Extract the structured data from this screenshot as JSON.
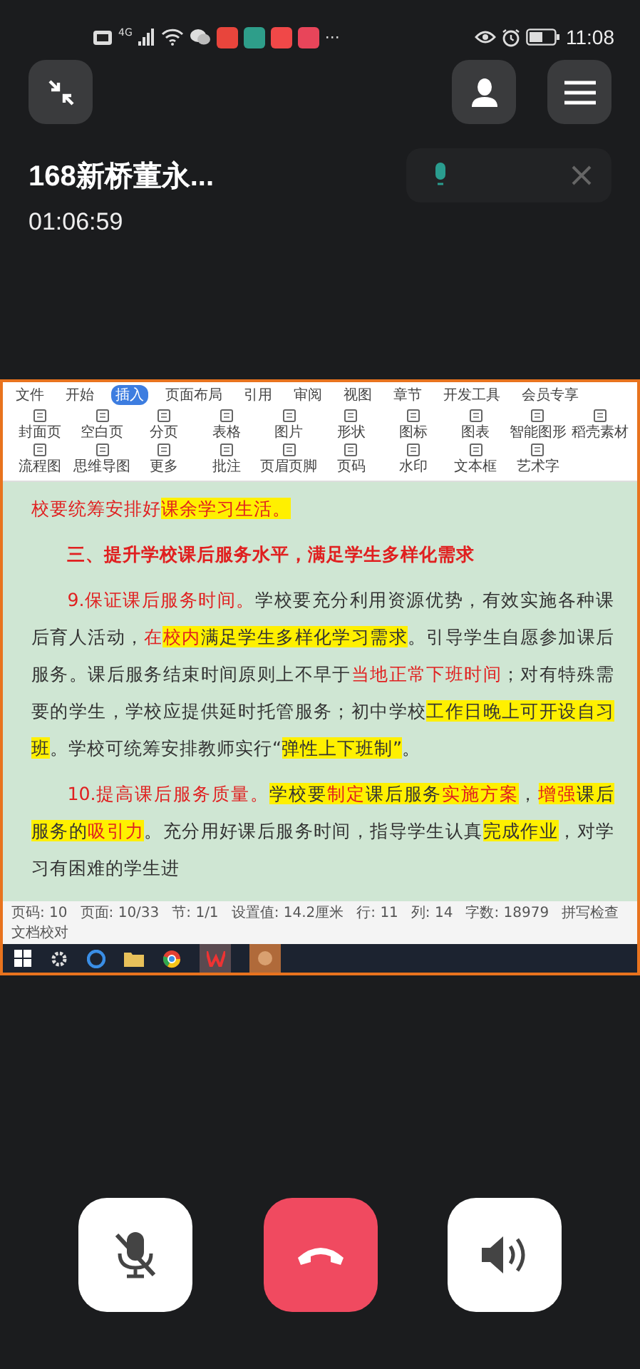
{
  "status_bar": {
    "time": "11:08",
    "more": "···",
    "network": "4G"
  },
  "call": {
    "name": "168新桥董永...",
    "duration": "01:06:59"
  },
  "shared_screen": {
    "menu_tabs": [
      {
        "label": "文件",
        "selected": false
      },
      {
        "label": "开始",
        "selected": false
      },
      {
        "label": "插入",
        "selected": true
      },
      {
        "label": "页面布局",
        "selected": false
      },
      {
        "label": "引用",
        "selected": false
      },
      {
        "label": "审阅",
        "selected": false
      },
      {
        "label": "视图",
        "selected": false
      },
      {
        "label": "章节",
        "selected": false
      },
      {
        "label": "开发工具",
        "selected": false
      },
      {
        "label": "会员专享",
        "selected": false
      }
    ],
    "ribbon": [
      "封面页",
      "空白页",
      "分页",
      "表格",
      "图片",
      "形状",
      "图标",
      "图表",
      "智能图形",
      "稻壳素材",
      "流程图",
      "思维导图",
      "更多",
      "批注",
      "页眉页脚",
      "页码",
      "水印",
      "文本框",
      "艺术字"
    ],
    "document": [
      {
        "kind": "body",
        "indent": false,
        "segments": [
          {
            "kind": "red",
            "text": "校要统筹安排好"
          },
          {
            "kind": "redhl",
            "text": "课余学习生活。"
          }
        ]
      },
      {
        "kind": "heading",
        "indent": true,
        "segments": [
          {
            "kind": "red",
            "text": "三、提升学校课后服务水平，满足学生多样化需求"
          }
        ]
      },
      {
        "kind": "body",
        "indent": true,
        "segments": [
          {
            "kind": "red",
            "text": "9.保证课后服务时间。"
          },
          {
            "kind": "plain",
            "text": "学校要充分利用资源优势，有效实施各种课后育人活动，"
          },
          {
            "kind": "red",
            "text": "在"
          },
          {
            "kind": "redhl",
            "text": "校内"
          },
          {
            "kind": "hl",
            "text": "满足学生多样化学习需求"
          },
          {
            "kind": "plain",
            "text": "。引导学生自愿参加课后服务。课后服务结束时间原则上不早于"
          },
          {
            "kind": "red",
            "text": "当地正常下班时间"
          },
          {
            "kind": "plain",
            "text": "；对有特殊需要的学生，学校应提供延时托管服务；初中学校"
          },
          {
            "kind": "hl",
            "text": "工作日晚上可开设自习班"
          },
          {
            "kind": "plain",
            "text": "。学校可统筹安排教师实行“"
          },
          {
            "kind": "hl",
            "text": "弹性上下班制”"
          },
          {
            "kind": "plain",
            "text": "。"
          }
        ]
      },
      {
        "kind": "body",
        "indent": true,
        "segments": [
          {
            "kind": "red",
            "text": "10.提高课后服务质量。"
          },
          {
            "kind": "hl",
            "text": "学校要"
          },
          {
            "kind": "redhl",
            "text": "制定"
          },
          {
            "kind": "hl",
            "text": "课后服务"
          },
          {
            "kind": "redhl",
            "text": "实施方案"
          },
          {
            "kind": "plain",
            "text": "，"
          },
          {
            "kind": "redhl",
            "text": "增强"
          },
          {
            "kind": "hl",
            "text": "课后服务的"
          },
          {
            "kind": "redhl",
            "text": "吸引力"
          },
          {
            "kind": "plain",
            "text": "。充分用好课后服务时间，指导学生认真"
          },
          {
            "kind": "hl",
            "text": "完成作业"
          },
          {
            "kind": "plain",
            "text": "，对学习有困难的学生进"
          }
        ]
      }
    ],
    "status": [
      "页码: 10",
      "页面: 10/33",
      "节: 1/1",
      "设置值: 14.2厘米",
      "行: 11",
      "列: 14",
      "字数: 18979",
      "拼写检查",
      "文档校对"
    ]
  },
  "controls": [
    {
      "kind": "mute",
      "muted": true
    },
    {
      "kind": "hangup"
    },
    {
      "kind": "speaker"
    }
  ]
}
